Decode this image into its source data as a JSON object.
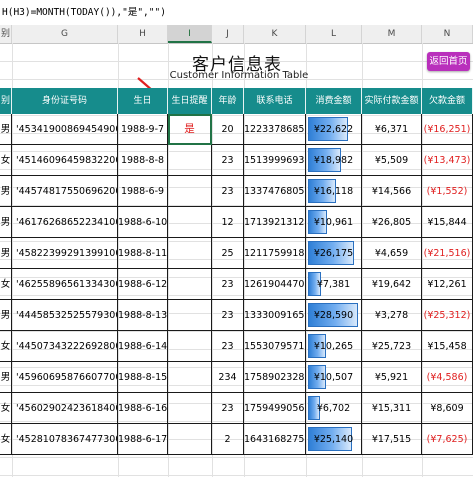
{
  "formula_bar": {
    "text": "H(H3)=MONTH(TODAY()),\"是\",\"\")"
  },
  "columns": [
    {
      "id": "F",
      "label": "别"
    },
    {
      "id": "G",
      "label": "G"
    },
    {
      "id": "H",
      "label": "H"
    },
    {
      "id": "I",
      "label": "I"
    },
    {
      "id": "J",
      "label": "J"
    },
    {
      "id": "K",
      "label": "K"
    },
    {
      "id": "L",
      "label": "L"
    },
    {
      "id": "M",
      "label": "M"
    },
    {
      "id": "N",
      "label": "N"
    }
  ],
  "selected_column": "I",
  "title": "客户信息表",
  "subtitle": "Customer Information Table",
  "back_button": "返回首页",
  "headers": [
    "别",
    "身份证号码",
    "生日",
    "生日提醒",
    "年龄",
    "联系电话",
    "消费金额",
    "实际付款金额",
    "欠款金额"
  ],
  "rows": [
    {
      "sex": "男",
      "id": "'453419008694549000",
      "birthday": "1988-9-7",
      "remind": "是",
      "age": "20",
      "phone": "12233786858",
      "spend": "¥22,622",
      "spend_val": 22622,
      "paid": "¥6,371",
      "debt": "(¥16,251)",
      "debt_neg": true
    },
    {
      "sex": "女",
      "id": "'451460964598322000",
      "birthday": "1988-8-8",
      "remind": "",
      "age": "23",
      "phone": "15139996934",
      "spend": "¥18,982",
      "spend_val": 18982,
      "paid": "¥5,509",
      "debt": "(¥13,473)",
      "debt_neg": true
    },
    {
      "sex": "男",
      "id": "'445748175506962000",
      "birthday": "1988-6-9",
      "remind": "",
      "age": "23",
      "phone": "13374768057",
      "spend": "¥16,118",
      "spend_val": 16118,
      "paid": "¥14,566",
      "debt": "(¥1,552)",
      "debt_neg": true
    },
    {
      "sex": "男",
      "id": "'461762686522341000",
      "birthday": "1988-6-10",
      "remind": "",
      "age": "12",
      "phone": "17139213122",
      "spend": "¥10,961",
      "spend_val": 10961,
      "paid": "¥26,805",
      "debt": "¥15,844",
      "debt_neg": false
    },
    {
      "sex": "男",
      "id": "'458223992913991000",
      "birthday": "1988-8-11",
      "remind": "",
      "age": "25",
      "phone": "12117599181",
      "spend": "¥26,175",
      "spend_val": 26175,
      "paid": "¥4,659",
      "debt": "(¥21,516)",
      "debt_neg": true
    },
    {
      "sex": "女",
      "id": "'462558965613343000",
      "birthday": "1988-6-12",
      "remind": "",
      "age": "23",
      "phone": "12619044702",
      "spend": "¥7,381",
      "spend_val": 7381,
      "paid": "¥19,642",
      "debt": "¥12,261",
      "debt_neg": false
    },
    {
      "sex": "男",
      "id": "'444585325255793000",
      "birthday": "1988-8-13",
      "remind": "",
      "age": "23",
      "phone": "13330091657",
      "spend": "¥28,590",
      "spend_val": 28590,
      "paid": "¥3,278",
      "debt": "(¥25,312)",
      "debt_neg": true
    },
    {
      "sex": "女",
      "id": "'445073432226928000",
      "birthday": "1988-6-14",
      "remind": "",
      "age": "23",
      "phone": "15530795715",
      "spend": "¥10,265",
      "spend_val": 10265,
      "paid": "¥25,723",
      "debt": "¥15,458",
      "debt_neg": false
    },
    {
      "sex": "男",
      "id": "'459606958766077000",
      "birthday": "1988-8-15",
      "remind": "",
      "age": "234",
      "phone": "17589023289",
      "spend": "¥10,507",
      "spend_val": 10507,
      "paid": "¥5,921",
      "debt": "(¥4,586)",
      "debt_neg": true
    },
    {
      "sex": "女",
      "id": "'456029024236184000",
      "birthday": "1988-6-16",
      "remind": "",
      "age": "23",
      "phone": "17594990565",
      "spend": "¥6,702",
      "spend_val": 6702,
      "paid": "¥15,311",
      "debt": "¥8,609",
      "debt_neg": false
    },
    {
      "sex": "女",
      "id": "'452810783674773000",
      "birthday": "1988-6-17",
      "remind": "",
      "age": "2",
      "phone": "16431682759",
      "spend": "¥25,140",
      "spend_val": 25140,
      "paid": "¥17,515",
      "debt": "(¥7,625)",
      "debt_neg": true
    }
  ],
  "spend_max": 28590,
  "colors": {
    "header_bg": "#168c8c",
    "negative": "#e02020",
    "button": "#b92fbc",
    "bar": "#2f7fd6"
  }
}
